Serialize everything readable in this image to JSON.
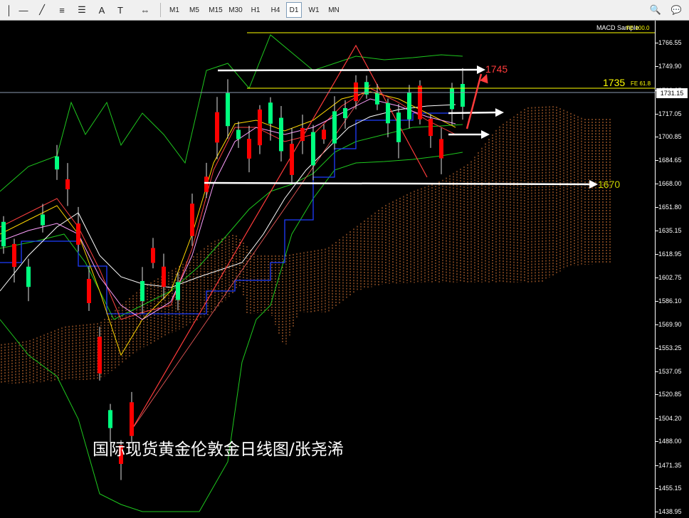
{
  "toolbar": {
    "drawing_tools": [
      {
        "name": "vertical-line-icon",
        "glyph": "│"
      },
      {
        "name": "horizontal-line-icon",
        "glyph": "—"
      },
      {
        "name": "trendline-icon",
        "glyph": "╱"
      },
      {
        "name": "equidistant-channel-icon",
        "glyph": "≡"
      },
      {
        "name": "fibonacci-retracement-icon",
        "glyph": "☰"
      },
      {
        "name": "text-icon",
        "glyph": "A"
      },
      {
        "name": "text-label-icon",
        "glyph": "T"
      },
      {
        "name": "arrows-icon",
        "glyph": "⇔"
      }
    ],
    "timeframes": [
      "M1",
      "M5",
      "M15",
      "M30",
      "H1",
      "H4",
      "D1",
      "W1",
      "MN"
    ],
    "active_timeframe": "D1",
    "right_icons": [
      {
        "name": "search-icon",
        "glyph": "🔍"
      },
      {
        "name": "community-icon",
        "glyph": "💬"
      }
    ]
  },
  "chart": {
    "indicator_label": "MACD Sample",
    "indicator_label_suffix": "FE 100.0",
    "watermark": "国际现货黄金伦敦金日线图/张尧浠",
    "current_price": "1731.15",
    "annotations": {
      "target_high": "1745",
      "level_1735": "1735",
      "level_1735_fe": "FE 61.8",
      "support_1670": "1670"
    },
    "colors": {
      "bull": "#00ff7f",
      "bear": "#ff0000",
      "cloud": "#ff8c40",
      "kijun": "#1e3cff",
      "bands": "#1ec81e",
      "level_line": "#ffff00",
      "annotation_red": "#ff3b3b"
    }
  },
  "price_axis": {
    "labels": [
      "1766.55",
      "1749.90",
      "1733.25",
      "1717.05",
      "1700.85",
      "1684.65",
      "1668.00",
      "1651.80",
      "1635.15",
      "1618.95",
      "1602.75",
      "1586.10",
      "1569.90",
      "1553.25",
      "1537.05",
      "1520.85",
      "1504.20",
      "1488.00",
      "1471.35",
      "1455.15",
      "1438.95"
    ],
    "max": 1766.55,
    "min": 1438.95
  }
}
